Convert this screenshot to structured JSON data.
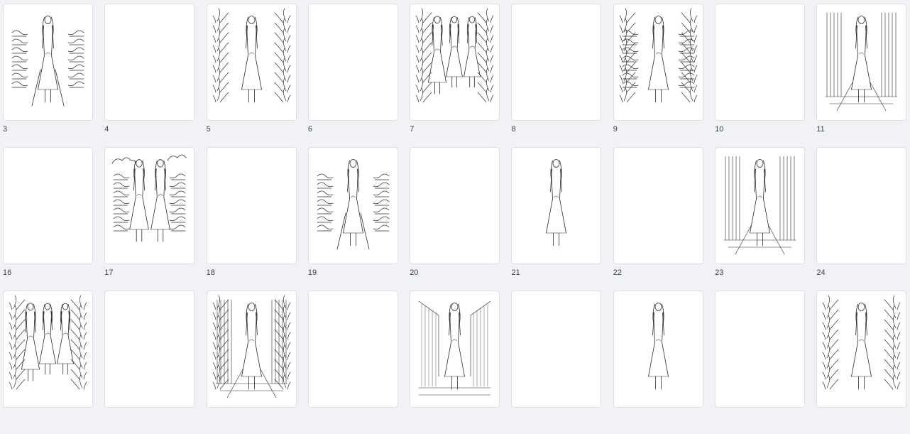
{
  "pages": [
    {
      "number": "3",
      "illustrated": true,
      "scene": "runway-audience",
      "figures": 1
    },
    {
      "number": "4",
      "illustrated": false
    },
    {
      "number": "5",
      "illustrated": true,
      "scene": "plants",
      "figures": 1
    },
    {
      "number": "6",
      "illustrated": false
    },
    {
      "number": "7",
      "illustrated": true,
      "scene": "plants",
      "figures": 3
    },
    {
      "number": "8",
      "illustrated": false
    },
    {
      "number": "9",
      "illustrated": true,
      "scene": "plants-audience",
      "figures": 1
    },
    {
      "number": "10",
      "illustrated": false
    },
    {
      "number": "11",
      "illustrated": true,
      "scene": "columns",
      "figures": 1
    },
    {
      "number": "16",
      "illustrated": false
    },
    {
      "number": "17",
      "illustrated": true,
      "scene": "clouds-audience",
      "figures": 2
    },
    {
      "number": "18",
      "illustrated": false
    },
    {
      "number": "19",
      "illustrated": true,
      "scene": "runway-audience",
      "figures": 1
    },
    {
      "number": "20",
      "illustrated": false
    },
    {
      "number": "21",
      "illustrated": true,
      "scene": "plain",
      "figures": 1
    },
    {
      "number": "22",
      "illustrated": false
    },
    {
      "number": "23",
      "illustrated": true,
      "scene": "columns",
      "figures": 1
    },
    {
      "number": "24",
      "illustrated": false
    },
    {
      "number": "",
      "illustrated": true,
      "scene": "plants",
      "figures": 3
    },
    {
      "number": "",
      "illustrated": false
    },
    {
      "number": "",
      "illustrated": true,
      "scene": "columns-plants",
      "figures": 1
    },
    {
      "number": "",
      "illustrated": false
    },
    {
      "number": "",
      "illustrated": true,
      "scene": "hall",
      "figures": 1
    },
    {
      "number": "",
      "illustrated": false
    },
    {
      "number": "",
      "illustrated": true,
      "scene": "plain",
      "figures": 1
    },
    {
      "number": "",
      "illustrated": false
    },
    {
      "number": "",
      "illustrated": true,
      "scene": "plants",
      "figures": 1
    }
  ],
  "colors": {
    "ink": "#2b2b2b",
    "page": "#ffffff",
    "background": "#f1f2f5"
  }
}
